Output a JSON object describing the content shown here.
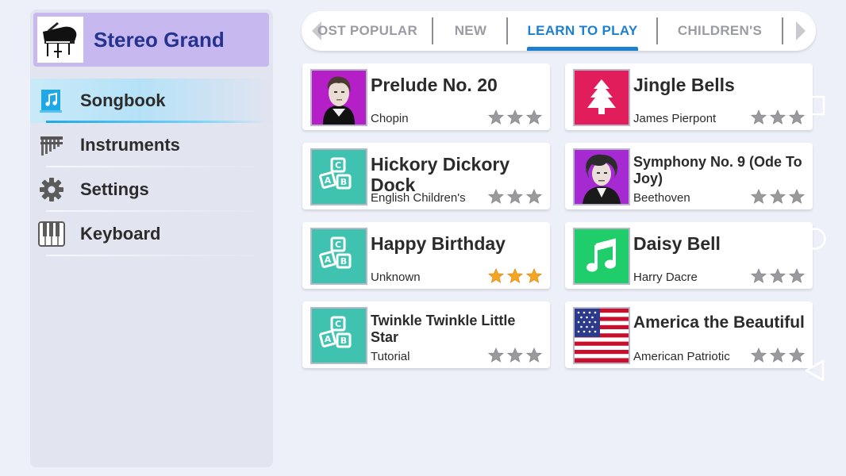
{
  "sidebar": {
    "instrument_name": "Stereo Grand",
    "items": [
      {
        "label": "Songbook",
        "icon": "songbook-icon",
        "active": true
      },
      {
        "label": "Instruments",
        "icon": "pan-flute-icon",
        "active": false
      },
      {
        "label": "Settings",
        "icon": "gear-icon",
        "active": false
      },
      {
        "label": "Keyboard",
        "icon": "piano-keys-icon",
        "active": false
      }
    ]
  },
  "tabs": [
    {
      "label": "OST POPULAR",
      "active": false
    },
    {
      "label": "NEW",
      "active": false
    },
    {
      "label": "LEARN TO PLAY",
      "active": true
    },
    {
      "label": "CHILDREN'S",
      "active": false
    }
  ],
  "songs": [
    {
      "title": "Prelude No. 20",
      "artist": "Chopin",
      "icon": "chopin-portrait",
      "stars": 0
    },
    {
      "title": "Jingle Bells",
      "artist": "James Pierpont",
      "icon": "christmas-tree-icon",
      "stars": 0
    },
    {
      "title": "Hickory Dickory Dock",
      "artist": "English Children's",
      "icon": "abc-blocks-icon",
      "stars": 0
    },
    {
      "title": "Symphony No. 9 (Ode To Joy)",
      "artist": "Beethoven",
      "icon": "beethoven-portrait",
      "stars": 0
    },
    {
      "title": "Happy Birthday",
      "artist": "Unknown",
      "icon": "abc-blocks-icon",
      "stars": 3
    },
    {
      "title": "Daisy Bell",
      "artist": "Harry Dacre",
      "icon": "music-note-icon",
      "stars": 0
    },
    {
      "title": "Twinkle Twinkle Little Star",
      "artist": "Tutorial",
      "icon": "abc-blocks-icon",
      "stars": 0
    },
    {
      "title": "America the Beautiful",
      "artist": "American Patriotic",
      "icon": "us-flag-icon",
      "stars": 0
    }
  ],
  "colors": {
    "accent": "#1d7fd0",
    "sidebar_header": "#c7b8ef",
    "star_on": "#f5a623",
    "star_off": "#9a9a9e",
    "christmas_tile": "#e11d5c",
    "blocks_tile": "#3fc2b0",
    "note_tile": "#1fce6a"
  }
}
